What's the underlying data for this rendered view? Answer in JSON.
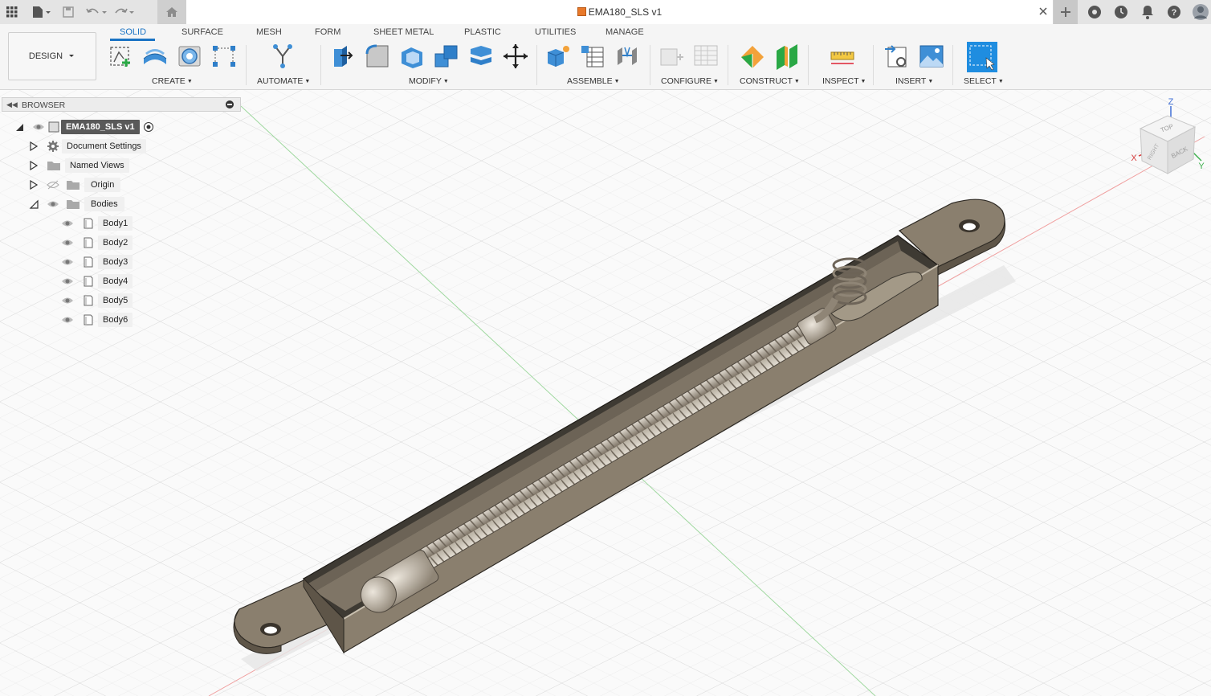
{
  "app": {
    "document_title": "EMA180_SLS v1"
  },
  "ribbon": {
    "workspace": "DESIGN",
    "tabs": [
      {
        "label": "SOLID",
        "active": true
      },
      {
        "label": "SURFACE",
        "active": false
      },
      {
        "label": "MESH",
        "active": false
      },
      {
        "label": "FORM",
        "active": false
      },
      {
        "label": "SHEET METAL",
        "active": false
      },
      {
        "label": "PLASTIC",
        "active": false
      },
      {
        "label": "UTILITIES",
        "active": false
      },
      {
        "label": "MANAGE",
        "active": false
      }
    ],
    "groups": [
      {
        "label": "CREATE"
      },
      {
        "label": "AUTOMATE"
      },
      {
        "label": "MODIFY"
      },
      {
        "label": "ASSEMBLE"
      },
      {
        "label": "CONFIGURE"
      },
      {
        "label": "CONSTRUCT"
      },
      {
        "label": "INSPECT"
      },
      {
        "label": "INSERT"
      },
      {
        "label": "SELECT"
      }
    ]
  },
  "browser": {
    "title": "BROWSER",
    "root": "EMA180_SLS v1",
    "items": [
      {
        "label": "Document Settings",
        "icon": "gear-icon"
      },
      {
        "label": "Named Views",
        "icon": "folder-icon"
      },
      {
        "label": "Origin",
        "icon": "folder-icon"
      },
      {
        "label": "Bodies",
        "icon": "folder-icon"
      }
    ],
    "bodies": [
      "Body1",
      "Body2",
      "Body3",
      "Body4",
      "Body5",
      "Body6"
    ]
  },
  "viewcube": {
    "top": "TOP",
    "back": "BACK",
    "right": "RIGHT",
    "axis_x": "X",
    "axis_y": "Y",
    "axis_z": "Z"
  },
  "colors": {
    "accent": "#1a73c4",
    "model": "#8a7f6e",
    "model_light": "#c9c0b0"
  }
}
